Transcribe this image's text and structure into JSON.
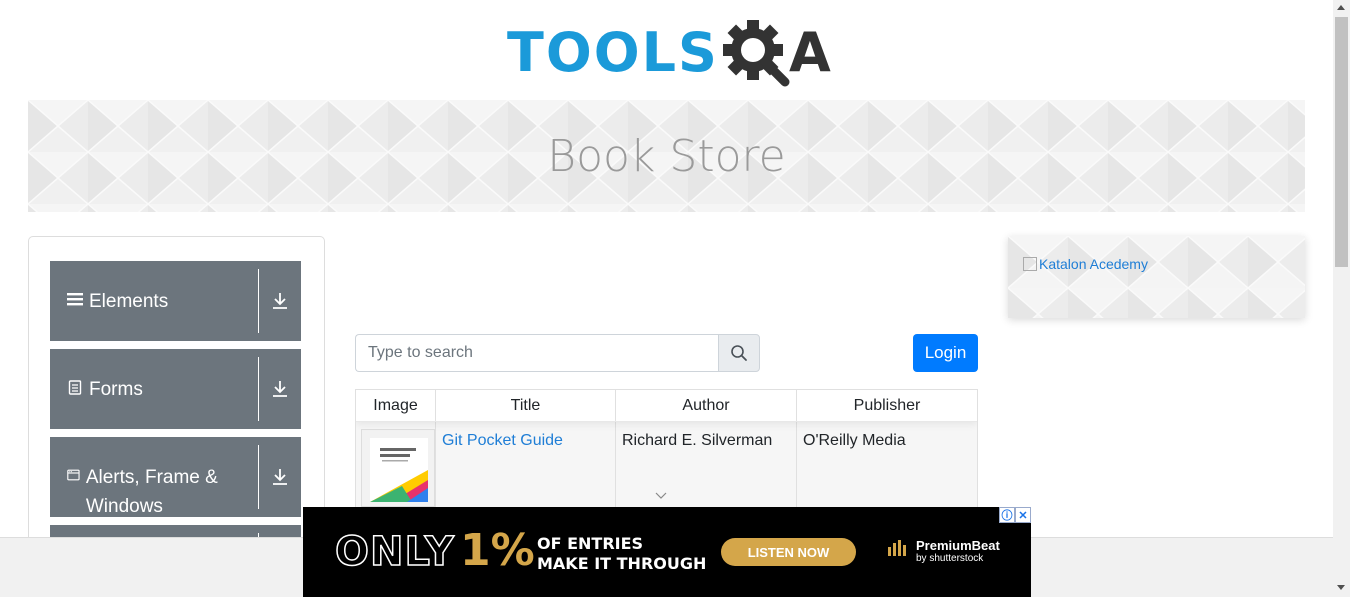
{
  "logo": {
    "part1": "TOOLS",
    "part2": "A",
    "colors": {
      "tools": "#1b9ad9",
      "qa": "#333333"
    }
  },
  "banner": {
    "title": "Book Store"
  },
  "sidebar": {
    "groups": [
      {
        "label": "Elements",
        "icon": "menu-icon"
      },
      {
        "label": "Forms",
        "icon": "document-icon"
      },
      {
        "label": "Alerts, Frame & Windows",
        "icon": "window-icon"
      },
      {
        "label": "",
        "icon": ""
      }
    ]
  },
  "search": {
    "placeholder": "Type to search",
    "value": ""
  },
  "login": {
    "label": "Login",
    "color": "#007bff"
  },
  "table": {
    "columns": [
      "Image",
      "Title",
      "Author",
      "Publisher"
    ],
    "rows": [
      {
        "title": "Git Pocket Guide",
        "author": "Richard E. Silverman",
        "publisher": "O'Reilly Media"
      }
    ]
  },
  "side_ad": {
    "alt": "Katalon Acedemy"
  },
  "bottom_ad": {
    "only": "ONLY",
    "pct": "1%",
    "line1": "OF ENTRIES",
    "line2": "MAKE IT THROUGH",
    "cta": "LISTEN NOW",
    "brand": "PremiumBeat",
    "brand_sub": "by shutterstock",
    "accent": "#d4a64a"
  }
}
